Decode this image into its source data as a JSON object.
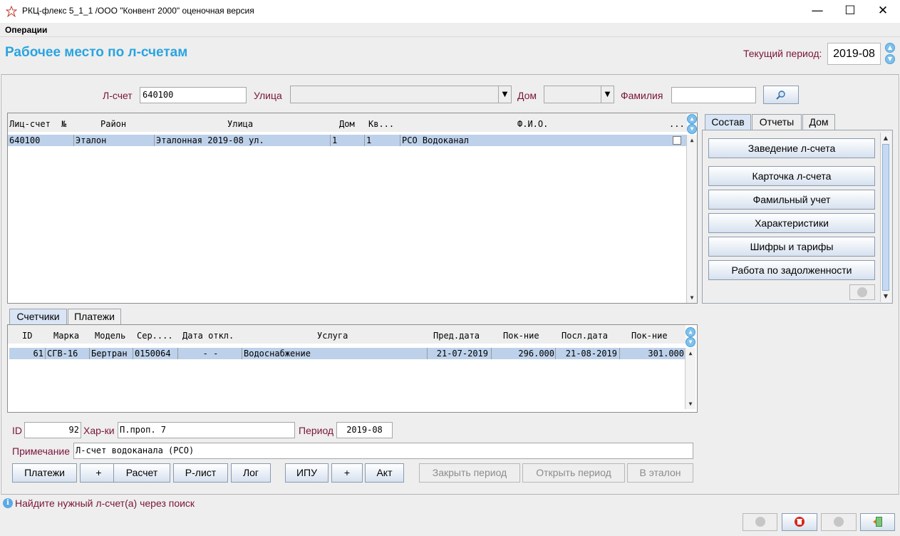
{
  "window": {
    "title": "РКЦ-флекс 5_1_1   /ООО \"Конвент 2000\" оценочная версия",
    "minimize_glyph": "—",
    "maximize_glyph": "☐",
    "close_glyph": "✕"
  },
  "menu": {
    "operations": "Операции"
  },
  "header": {
    "title": "Рабочее место по л-счетам",
    "period_label": "Текущий период:",
    "period_value": "2019-08"
  },
  "search": {
    "account_label": "Л-счет",
    "account_value": "640100",
    "street_label": "Улица",
    "street_value": "",
    "house_label": "Дом",
    "house_value": "",
    "surname_label": "Фамилия",
    "surname_value": "",
    "search_icon": "magnifier-icon"
  },
  "accounts_table": {
    "columns": [
      "Лиц-счет",
      "№",
      "Район",
      "Улица",
      "Дом",
      "Кв...",
      "Ф.И.О.",
      "..."
    ],
    "rows": [
      {
        "account": "640100",
        "district": "Эталон",
        "street": "Эталонная 2019-08 ул.",
        "house": "1",
        "apt": "1",
        "name": "РСО Водоканал"
      }
    ]
  },
  "right_panel": {
    "tabs": [
      "Состав",
      "Отчеты",
      "Дом"
    ],
    "buttons": [
      "Заведение л-счета",
      "Карточка л-счета",
      "Фамильный учет",
      "Характеристики",
      "Шифры и тарифы",
      "Работа по задолженности"
    ]
  },
  "bottom_tabs": [
    "Счетчики",
    "Платежи"
  ],
  "meters_table": {
    "columns": [
      "ID",
      "Марка",
      "Модель",
      "Сер....",
      "Дата откл.",
      "Услуга",
      "Пред.дата",
      "Пок-ние",
      "Посл.дата",
      "Пок-ние"
    ],
    "rows": [
      {
        "id": "61",
        "brand": "СГВ-16",
        "model": "Бертран",
        "serial": "0150064",
        "off_date": "-   -",
        "service": "Водоснабжение",
        "prev_date": "21-07-2019",
        "prev_reading": "296.000",
        "last_date": "21-08-2019",
        "last_reading": "301.000"
      }
    ]
  },
  "details": {
    "id_label": "ID",
    "id_value": "92",
    "char_label": "Хар-ки",
    "char_value": "П.проп. 7",
    "period_label": "Период",
    "period_value": "2019-08",
    "note_label": "Примечание",
    "note_value": "Л-счет водоканала (РСО)"
  },
  "actions": {
    "payments": "Платежи",
    "plus1": "+",
    "calc": "Расчет",
    "rlist": "Р-лист",
    "log": "Лог",
    "ipu": "ИПУ",
    "plus2": "+",
    "act": "Акт",
    "close_period": "Закрыть период",
    "open_period": "Открыть период",
    "to_etalon": "В эталон"
  },
  "status": {
    "message": "Найдите нужный л-счет(а) через поиск"
  },
  "colors": {
    "accent": "#29a4e0",
    "label": "#7a1538",
    "selection": "#bdd1ea"
  }
}
